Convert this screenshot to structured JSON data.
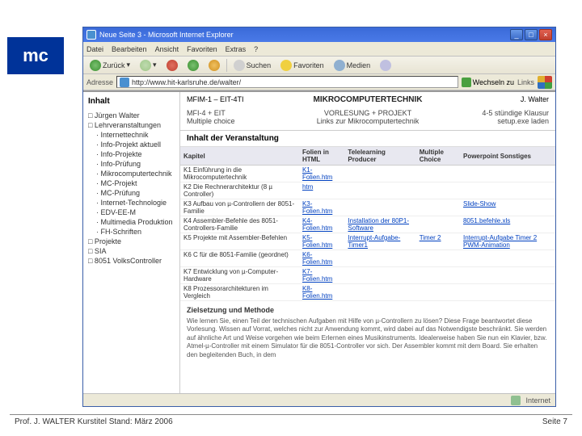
{
  "slide": {
    "badge": "mc",
    "footer_left": "Prof. J. WALTER  Kurstitel  Stand: März 2006",
    "footer_right": "Seite 7"
  },
  "browser": {
    "title": "Neue Seite 3 - Microsoft Internet Explorer",
    "menus": [
      "Datei",
      "Bearbeiten",
      "Ansicht",
      "Favoriten",
      "Extras",
      "?"
    ],
    "toolbar": {
      "back": "Zurück",
      "search": "Suchen",
      "favorites": "Favoriten",
      "media": "Medien"
    },
    "addr_label": "Adresse",
    "url": "http://www.hit-karlsruhe.de/walter/",
    "go": "Wechseln zu",
    "links": "Links",
    "status_zone": "Internet"
  },
  "page": {
    "sidebar_title": "Inhalt",
    "sidebar": [
      {
        "t": "Jürgen Walter"
      },
      {
        "t": "Lehrveranstaltungen"
      },
      {
        "t": "Internettechnik",
        "sub": true
      },
      {
        "t": "Info-Projekt aktuell",
        "sub": true
      },
      {
        "t": "Info-Projekte",
        "sub": true
      },
      {
        "t": "Info-Prüfung",
        "sub": true
      },
      {
        "t": "Mikrocomputertechnik",
        "sub": true
      },
      {
        "t": "MC-Projekt",
        "sub": true
      },
      {
        "t": "MC-Prüfung",
        "sub": true
      },
      {
        "t": "Internet-Technologie",
        "sub": true
      },
      {
        "t": "EDV-EE-M",
        "sub": true
      },
      {
        "t": "Multimedia Produktion",
        "sub": true
      },
      {
        "t": "FH-Schriften",
        "sub": true
      },
      {
        "t": "Projekte"
      },
      {
        "t": "SIA"
      },
      {
        "t": "8051 VolksController"
      }
    ],
    "top_left_small": "MFIM-1 – EIT-4TI",
    "top_mid": "MIKROCOMPUTERTECHNIK",
    "top_right": "J. Walter",
    "row2_left": "MFI-4 + EIT",
    "row2_left2": "Multiple choice",
    "row2_mid": "VORLESUNG + PROJEKT",
    "row2_mid2": "Links zur Mikrocomputertechnik",
    "row2_right": "4-5 stündige Klausur",
    "row2_right2": "setup.exe laden",
    "subtitle": "Inhalt der Veranstaltung",
    "table": {
      "headers": [
        "Kapitel",
        "Folien in HTML",
        "Telelearning Producer",
        "Multiple Choice",
        "Powerpoint Sonstiges"
      ],
      "rows": [
        {
          "k": "K1 Einführung in die Mikrocomputertechnik",
          "f": "K1-Folien.htm",
          "t": "",
          "m": "",
          "p": ""
        },
        {
          "k": "K2 Die Rechnerarchitektur (8 µ Controller)",
          "f": "htm",
          "t": "",
          "m": "",
          "p": ""
        },
        {
          "k": "K3 Aufbau von µ-Controllern der 8051-Familie",
          "f": "K3-Folien.htm",
          "t": "",
          "m": "",
          "p": "Slide-Show"
        },
        {
          "k": "K4 Assembler-Befehle des 8051-Controllers-Familie",
          "f": "K4-Folien.htm",
          "t": "Installation der 80P1-Software",
          "m": "",
          "p": "8051.befehle.xls"
        },
        {
          "k": "K5 Projekte mit Assembler-Befehlen",
          "f": "K5-Folien.htm",
          "t": "Interrupt-Aufgabe-Timer1",
          "m": "Timer 2",
          "p": "Interrupt-Aufgabe Timer 2 PWM-Animation"
        },
        {
          "k": "K6 C für die 8051-Familie (geordnet)",
          "f": "K6-Folien.htm",
          "t": "",
          "m": "",
          "p": ""
        },
        {
          "k": "K7 Entwicklung von µ-Computer-Hardware",
          "f": "K7-Folien.htm",
          "t": "",
          "m": "",
          "p": ""
        },
        {
          "k": "K8 Prozessorarchitekturen im Vergleich",
          "f": "K8-Folien.htm",
          "t": "",
          "m": "",
          "p": ""
        }
      ]
    },
    "ziel_title": "Zielsetzung und Methode",
    "ziel_text": "Wie lernen Sie, einen Teil der technischen Aufgaben mit Hilfe von µ-Controllern zu lösen? Diese Frage beantwortet diese Vorlesung. Wissen auf Vorrat, welches nicht zur Anwendung kommt, wird dabei auf das Notwendigste beschränkt. Sie werden auf ähnliche Art und Weise vorgehen wie beim Erlernen eines Musikinstruments. Idealerweise haben Sie nun ein Klavier, bzw. Atmel-µ-Controller mit einem Simulator für die 8051-Controller vor sich. Der Assembler kommt mit dem Board. Sie erhalten den begleitenden Buch, in dem"
  }
}
